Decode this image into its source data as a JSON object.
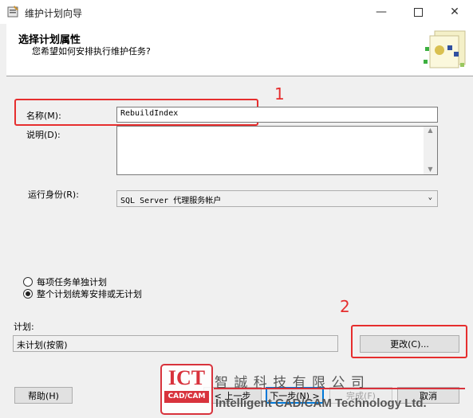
{
  "window": {
    "title": "维护计划向导"
  },
  "header": {
    "title": "选择计划属性",
    "subtitle": "您希望如何安排执行维护任务?"
  },
  "form": {
    "name_label": "名称(M):",
    "name_value": "RebuildIndex",
    "description_label": "说明(D):",
    "description_value": "",
    "run_as_label": "运行身份(R):",
    "run_as_value": "SQL Server 代理服务帐户"
  },
  "schedule_options": [
    {
      "label": "每项任务单独计划",
      "selected": false
    },
    {
      "label": "整个计划统筹安排或无计划",
      "selected": true
    }
  ],
  "schedule": {
    "label": "计划:",
    "value": "未计划(按需)",
    "change_button": "更改(C)..."
  },
  "footer": {
    "help": "帮助(H)",
    "back": "< 上一步",
    "next": "下一步(N) >",
    "finish": "完成(F)",
    "cancel": "取消"
  },
  "annotations": {
    "marker_1": "1",
    "marker_2": "2"
  },
  "watermark": {
    "logo": "ICT",
    "logo_sub": "CAD/CAM",
    "company_cn": "智 誠 科 技 有 限 公 司",
    "company_en": "Intelligent CAD/CAM Technology Ltd."
  },
  "colors": {
    "annotation_red": "#e62e2e",
    "focus_blue": "#0078d7"
  }
}
